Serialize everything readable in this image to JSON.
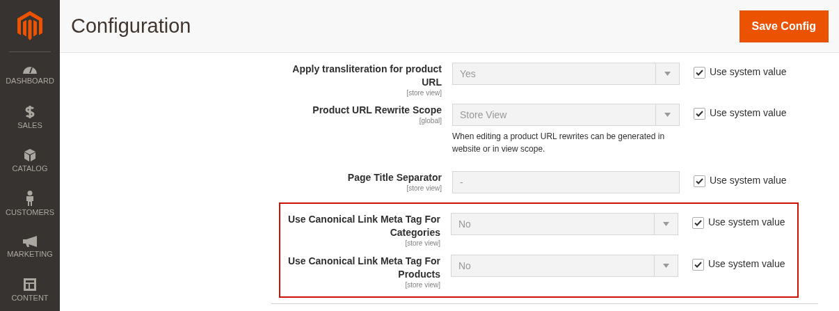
{
  "sidebar": {
    "items": [
      {
        "label": "DASHBOARD"
      },
      {
        "label": "SALES"
      },
      {
        "label": "CATALOG"
      },
      {
        "label": "CUSTOMERS"
      },
      {
        "label": "MARKETING"
      },
      {
        "label": "CONTENT"
      }
    ]
  },
  "header": {
    "title": "Configuration",
    "button": "Save Config"
  },
  "groups": [
    {
      "highlighted": false,
      "rows": [
        {
          "kind": "select",
          "label": "Apply transliteration for product URL",
          "scope": "[store view]",
          "value": "Yes",
          "use_system_value": {
            "label": "Use system value",
            "checked": true
          }
        },
        {
          "kind": "select",
          "label": "Product URL Rewrite Scope",
          "scope": "[global]",
          "value": "Store View",
          "note": "When editing a product URL rewrites can be generated in website or in view scope.",
          "use_system_value": {
            "label": "Use system value",
            "checked": true
          }
        },
        {
          "kind": "text",
          "label": "Page Title Separator",
          "scope": "[store view]",
          "value": "-",
          "use_system_value": {
            "label": "Use system value",
            "checked": true
          }
        }
      ]
    },
    {
      "highlighted": true,
      "rows": [
        {
          "kind": "select",
          "label": "Use Canonical Link Meta Tag For Categories",
          "scope": "[store view]",
          "value": "No",
          "use_system_value": {
            "label": "Use system value",
            "checked": true
          }
        },
        {
          "kind": "select",
          "label": "Use Canonical Link Meta Tag For Products",
          "scope": "[store view]",
          "value": "No",
          "use_system_value": {
            "label": "Use system value",
            "checked": true
          }
        }
      ]
    }
  ]
}
